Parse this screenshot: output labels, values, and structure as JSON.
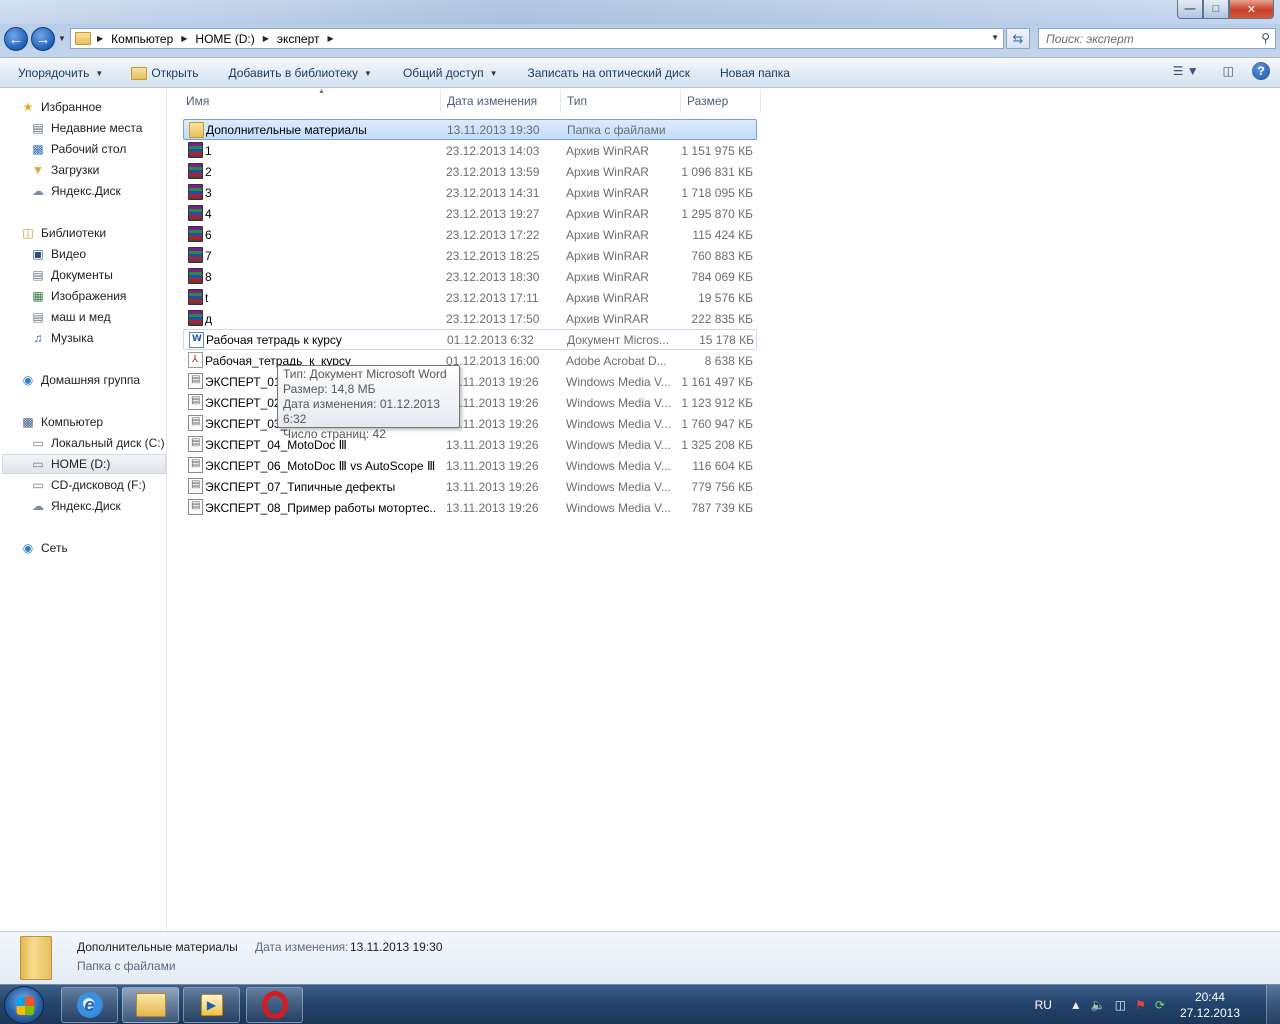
{
  "window": {
    "controls": {
      "minimize": "—",
      "maximize": "□",
      "close": "✕"
    }
  },
  "address": {
    "crumbs": [
      "Компьютер",
      "HOME (D:)",
      "эксперт"
    ]
  },
  "search": {
    "placeholder": "Поиск: эксперт"
  },
  "toolbar": {
    "organize": "Упорядочить",
    "open": "Открыть",
    "add_library": "Добавить в библиотеку",
    "share": "Общий доступ",
    "burn": "Записать на оптический диск",
    "new_folder": "Новая папка"
  },
  "nav": {
    "favorites": "Избранное",
    "recent": "Недавние места",
    "desktop": "Рабочий стол",
    "downloads": "Загрузки",
    "yadisk1": "Яндекс.Диск",
    "libraries": "Библиотеки",
    "video": "Видео",
    "docs": "Документы",
    "images": "Изображения",
    "mash": "маш и мед",
    "music": "Музыка",
    "homegroup": "Домашняя группа",
    "computer": "Компьютер",
    "local_c": "Локальный диск (C:)",
    "home_d": "HOME (D:)",
    "cd_f": "CD-дисковод (F:)",
    "yadisk2": "Яндекс.Диск",
    "network": "Сеть"
  },
  "columns": {
    "name": "Имя",
    "date": "Дата изменения",
    "type": "Тип",
    "size": "Размер"
  },
  "files": [
    {
      "name": "Дополнительные материалы",
      "date": "13.11.2013 19:30",
      "type": "Папка с файлами",
      "size": ""
    },
    {
      "name": "1",
      "date": "23.12.2013 14:03",
      "type": "Архив WinRAR",
      "size": "1 151 975 КБ"
    },
    {
      "name": "2",
      "date": "23.12.2013 13:59",
      "type": "Архив WinRAR",
      "size": "1 096 831 КБ"
    },
    {
      "name": "3",
      "date": "23.12.2013 14:31",
      "type": "Архив WinRAR",
      "size": "1 718 095 КБ"
    },
    {
      "name": "4",
      "date": "23.12.2013 19:27",
      "type": "Архив WinRAR",
      "size": "1 295 870 КБ"
    },
    {
      "name": "6",
      "date": "23.12.2013 17:22",
      "type": "Архив WinRAR",
      "size": "115 424 КБ"
    },
    {
      "name": "7",
      "date": "23.12.2013 18:25",
      "type": "Архив WinRAR",
      "size": "760 883 КБ"
    },
    {
      "name": "8",
      "date": "23.12.2013 18:30",
      "type": "Архив WinRAR",
      "size": "784 069 КБ"
    },
    {
      "name": "t",
      "date": "23.12.2013 17:11",
      "type": "Архив WinRAR",
      "size": "19 576 КБ"
    },
    {
      "name": "д",
      "date": "23.12.2013 17:50",
      "type": "Архив WinRAR",
      "size": "222 835 КБ"
    },
    {
      "name": "Рабочая тетрадь к курсу",
      "date": "01.12.2013 6:32",
      "type": "Документ Micros...",
      "size": "15 178 КБ"
    },
    {
      "name": "Рабочая_тетрадь_к_курсу",
      "date": "01.12.2013 16:00",
      "type": "Adobe Acrobat D...",
      "size": "8 638 КБ"
    },
    {
      "name": "ЭКСПЕРТ_01_",
      "date": "13.11.2013 19:26",
      "type": "Windows Media V...",
      "size": "1 161 497 КБ"
    },
    {
      "name": "ЭКСПЕРТ_02_",
      "date": "13.11.2013 19:26",
      "type": "Windows Media V...",
      "size": "1 123 912 КБ"
    },
    {
      "name": "ЭКСПЕРТ_03_",
      "date": "13.11.2013 19:26",
      "type": "Windows Media V...",
      "size": "1 760 947 КБ"
    },
    {
      "name": "ЭКСПЕРТ_04_MotoDoc Ⅲ",
      "date": "13.11.2013 19:26",
      "type": "Windows Media V...",
      "size": "1 325 208 КБ"
    },
    {
      "name": "ЭКСПЕРТ_06_MotoDoc Ⅲ vs AutoScope Ⅲ",
      "date": "13.11.2013 19:26",
      "type": "Windows Media V...",
      "size": "116 604 КБ"
    },
    {
      "name": "ЭКСПЕРТ_07_Типичные дефекты",
      "date": "13.11.2013 19:26",
      "type": "Windows Media V...",
      "size": "779 756 КБ"
    },
    {
      "name": "ЭКСПЕРТ_08_Пример работы мотортес...",
      "date": "13.11.2013 19:26",
      "type": "Windows Media V...",
      "size": "787 739 КБ"
    }
  ],
  "tooltip": {
    "line1": "Тип: Документ Microsoft Word",
    "line2": "Размер: 14,8 МБ",
    "line3": "Дата изменения: 01.12.2013 6:32",
    "line4": "Число страниц: 42"
  },
  "details": {
    "name": "Дополнительные материалы",
    "date_label": "Дата изменения:",
    "date_value": "13.11.2013 19:30",
    "type": "Папка с файлами"
  },
  "taskbar": {
    "lang": "RU",
    "time": "20:44",
    "date": "27.12.2013"
  }
}
